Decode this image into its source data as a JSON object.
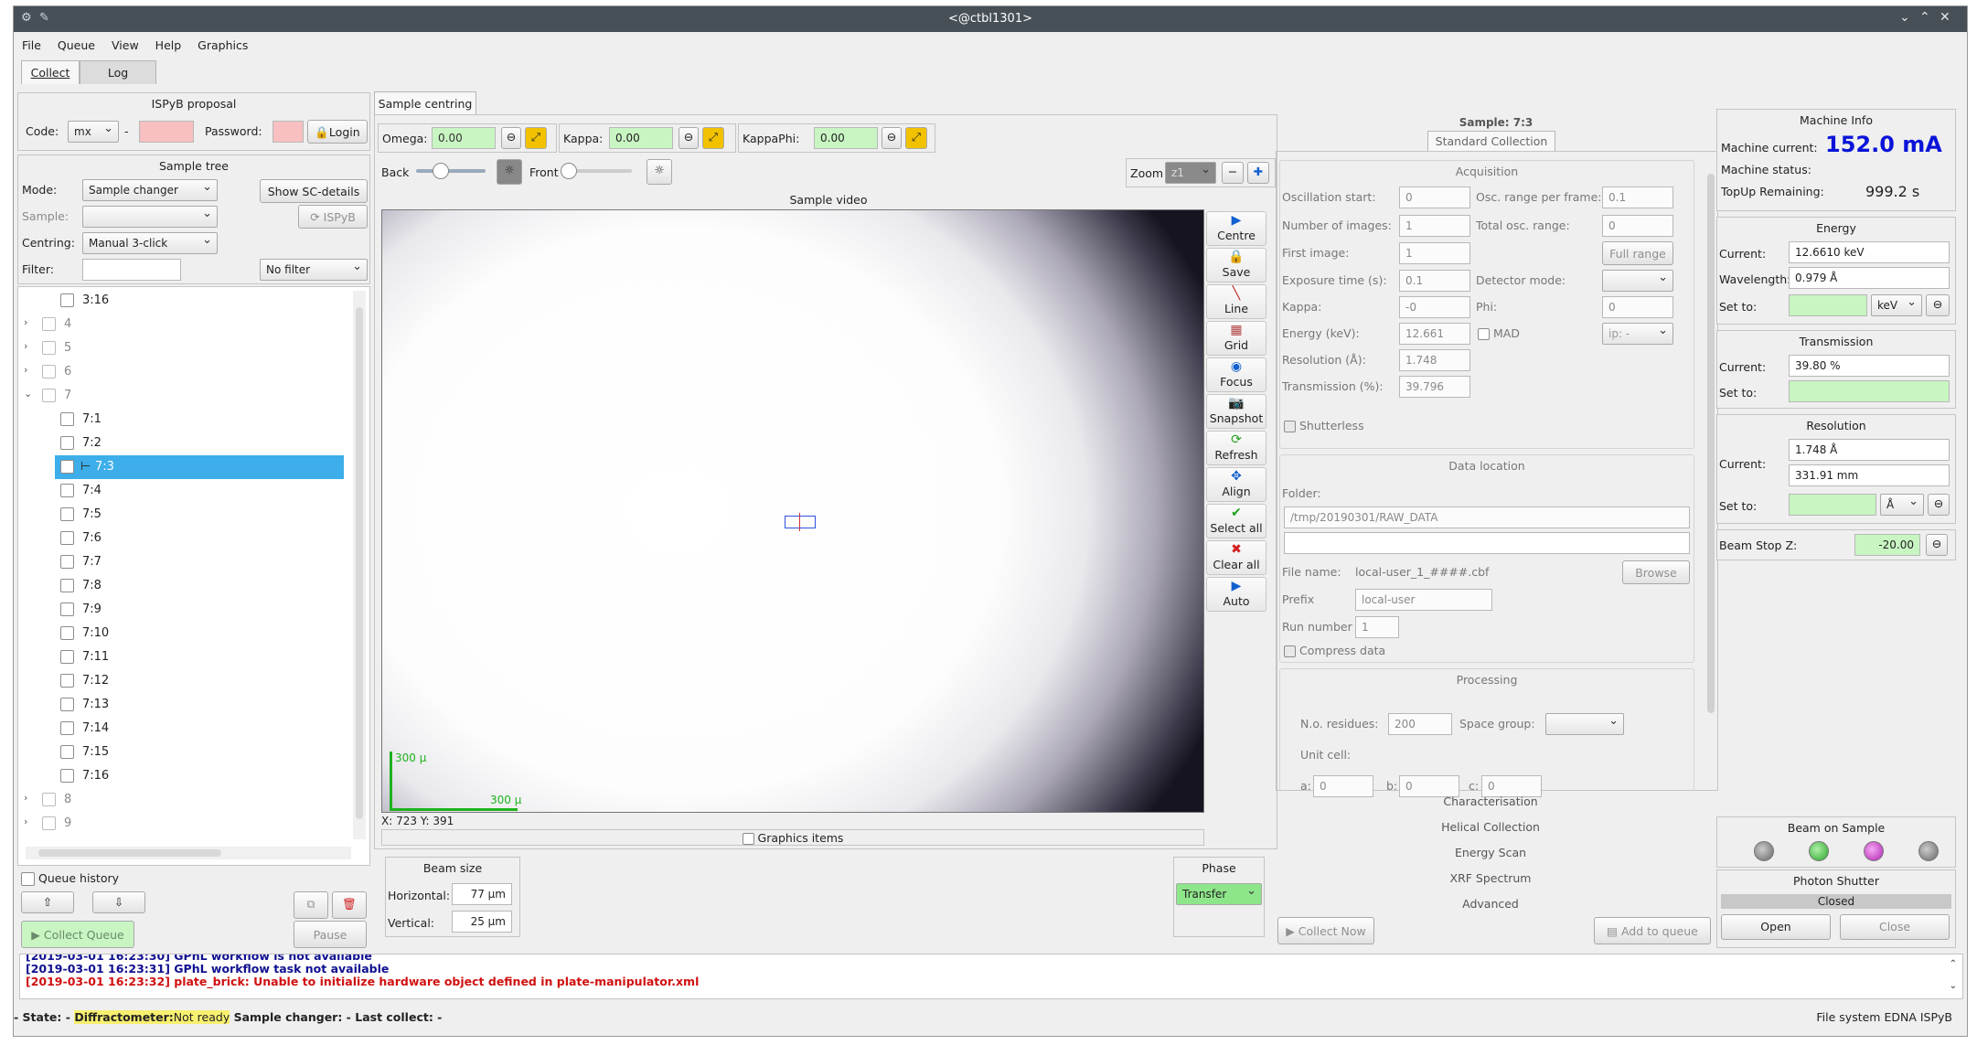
{
  "window": {
    "title": "<@ctbl1301>"
  },
  "menu": [
    "File",
    "Queue",
    "View",
    "Help",
    "Graphics"
  ],
  "tabs": [
    "Collect",
    "Log"
  ],
  "ispyb": {
    "title": "ISPyB proposal",
    "code_label": "Code:",
    "code_value": "mx",
    "dash": "-",
    "password_label": "Password:",
    "login": "Login"
  },
  "sample_tree": {
    "title": "Sample tree",
    "mode_label": "Mode:",
    "mode_value": "Sample changer",
    "show_sc": "Show SC-details",
    "sample_label": "Sample:",
    "ispyb_btn": "ISPyB",
    "centring_label": "Centring:",
    "centring_value": "Manual 3-click",
    "filter_label": "Filter:",
    "filter_value": "No filter",
    "rows": [
      "3:16",
      "4",
      "5",
      "6",
      "7",
      "7:1",
      "7:2",
      "7:3",
      "7:4",
      "7:5",
      "7:6",
      "7:7",
      "7:8",
      "7:9",
      "7:10",
      "7:11",
      "7:12",
      "7:13",
      "7:14",
      "7:15",
      "7:16",
      "8",
      "9"
    ],
    "queue_history": "Queue history",
    "collect_queue": "Collect Queue",
    "pause": "Pause"
  },
  "centring": {
    "tab": "Sample centring",
    "omega_label": "Omega:",
    "omega": "0.00",
    "kappa_label": "Kappa:",
    "kappa": "0.00",
    "kappaphi_label": "KappaPhi:",
    "kappaphi": "0.00",
    "back": "Back",
    "front": "Front",
    "zoom_label": "Zoom",
    "zoom_value": "z1"
  },
  "video": {
    "title": "Sample video",
    "scale_v": "300 µ",
    "scale_h": "300 µ",
    "coords": "X: 723 Y: 391",
    "graphics_items": "Graphics items",
    "buttons": [
      "Centre",
      "Save",
      "Line",
      "Grid",
      "Focus",
      "Snapshot",
      "Refresh",
      "Align",
      "Select all",
      "Clear all",
      "Auto"
    ]
  },
  "beam_size": {
    "title": "Beam size",
    "horizontal_label": "Horizontal:",
    "horizontal": "77 µm",
    "vertical_label": "Vertical:",
    "vertical": "25 µm"
  },
  "phase": {
    "title": "Phase",
    "value": "Transfer"
  },
  "params": {
    "sample": "Sample: 7:3",
    "tab": "Standard Collection",
    "acquisition": {
      "title": "Acquisition",
      "osc_start_label": "Oscillation start:",
      "osc_start": "0",
      "osc_range_label": "Osc. range per frame:",
      "osc_range": "0.1",
      "num_images_label": "Number of images:",
      "num_images": "1",
      "total_osc_label": "Total osc. range:",
      "total_osc": "0",
      "first_image_label": "First image:",
      "first_image": "1",
      "full_range": "Full range",
      "exposure_label": "Exposure time (s):",
      "exposure": "0.1",
      "detector_mode_label": "Detector mode:",
      "kappa_label": "Kappa:",
      "kappa": "-0",
      "phi_label": "Phi:",
      "phi": "0",
      "energy_label": "Energy (keV):",
      "energy": "12.661",
      "mad": "MAD",
      "mad_combo": "ip: -",
      "resolution_label": "Resolution (Å):",
      "resolution": "1.748",
      "transmission_label": "Transmission (%):",
      "transmission": "39.796",
      "shutterless": "Shutterless"
    },
    "data_location": {
      "title": "Data location",
      "folder_label": "Folder:",
      "folder": "/tmp/20190301/RAW_DATA",
      "file_name_label": "File name:",
      "file_name": "local-user_1_####.cbf",
      "browse": "Browse",
      "prefix_label": "Prefix",
      "prefix": "local-user",
      "run_label": "Run number",
      "run": "1",
      "compress": "Compress data"
    },
    "processing": {
      "title": "Processing",
      "residues_label": "N.o. residues:",
      "residues": "200",
      "space_group_label": "Space group:",
      "unit_cell_label": "Unit cell:",
      "a_label": "a:",
      "a": "0",
      "b_label": "b:",
      "b": "0",
      "c_label": "c:",
      "c": "0"
    },
    "sections": [
      "Characterisation",
      "Helical Collection",
      "Energy Scan",
      "XRF Spectrum",
      "Advanced"
    ],
    "collect_now": "Collect Now",
    "add_to_queue": "Add to queue"
  },
  "machine": {
    "title": "Machine Info",
    "current_label": "Machine current:",
    "current": "152.0 mA",
    "status_label": "Machine status:",
    "topup_label": "TopUp Remaining:",
    "topup": "999.2 s"
  },
  "energy": {
    "title": "Energy",
    "current_label": "Current:",
    "current": "12.6610 keV",
    "wavelength_label": "Wavelength:",
    "wavelength": "0.979 Å",
    "set_label": "Set to:",
    "unit": "keV"
  },
  "transmission": {
    "title": "Transmission",
    "current_label": "Current:",
    "current": "39.80 %",
    "set_label": "Set to:"
  },
  "resolution": {
    "title": "Resolution",
    "current_label": "Current:",
    "current_a": "1.748 Å",
    "current_mm": "331.91 mm",
    "set_label": "Set to:",
    "unit": "Å"
  },
  "beamstop": {
    "label": "Beam Stop Z:",
    "value": "-20.00"
  },
  "beam_on_sample": {
    "title": "Beam on Sample"
  },
  "shutter": {
    "title": "Photon Shutter",
    "state": "Closed",
    "open": "Open",
    "close": "Close"
  },
  "log": [
    "[2019-03-01 16:23:30] GPhL workflow is not available",
    "[2019-03-01 16:23:31] GPhL workflow task not available",
    "[2019-03-01 16:23:32] plate_brick: Unable to initialize hardware object defined in plate-manipulator.xml"
  ],
  "status": {
    "state": "- State: -",
    "diff_label": "Diffractometer:",
    "diff_value": "Not ready",
    "sc": "Sample changer: -",
    "last": "Last collect: -",
    "right": "File system  EDNA  ISPyB"
  },
  "colors": {
    "selection": "#3daee9",
    "machine_current": "#0a14d8",
    "log_error": "#d01010",
    "log_info": "#101090",
    "highlight": "#f8f070"
  }
}
